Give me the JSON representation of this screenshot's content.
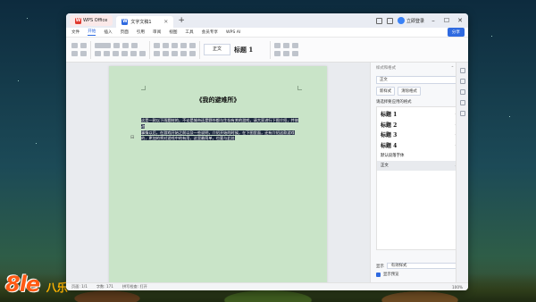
{
  "app_tab": "WPS Office",
  "doc_tab": "文字文稿1",
  "user_name": "立即登录",
  "menu": {
    "file": "文件",
    "items": [
      "开始",
      "插入",
      "页面",
      "引用",
      "审阅",
      "视图",
      "工具",
      "会员专享",
      "WPS AI"
    ],
    "active": "开始",
    "share": "分享"
  },
  "toolbar": {
    "style_normal": "正文",
    "style_h1": "标题 1"
  },
  "document": {
    "title": "《我的避难所》",
    "body_lines": [
      "这是一款以下雨题材的，不论是城市还是野外都与生存有关的游戏，请大家进行下图介绍，并修改",
      "事情以后，在游戏开始之前以及一些说明，介绍开始的时候，在下图里面，还有介绍这款游戏",
      "的，更加的将对游戏中的有用，这里最简单，也要与此处"
    ]
  },
  "panel": {
    "header": "样式和格式",
    "current_style": "正文",
    "btn_new": "新样式",
    "btn_clear": "清除格式",
    "list_label": "请选择要应用的格式",
    "styles": [
      {
        "name": "标题 1",
        "mark": "↵"
      },
      {
        "name": "标题 2",
        "mark": "↵"
      },
      {
        "name": "标题 3",
        "mark": "↵"
      },
      {
        "name": "标题 4",
        "mark": "↵"
      },
      {
        "name": "默认段落字体",
        "mark": "a"
      },
      {
        "name": "正文",
        "mark": "↵"
      }
    ],
    "show_label": "显示",
    "show_value": "有效样式",
    "preview": "显示预览"
  },
  "status": {
    "page": "页面: 1/1",
    "words": "字数: 171",
    "spell": "拼写检查: 打开",
    "zoom": "100%"
  },
  "watermark": {
    "number": "8le",
    "text": "八乐"
  }
}
